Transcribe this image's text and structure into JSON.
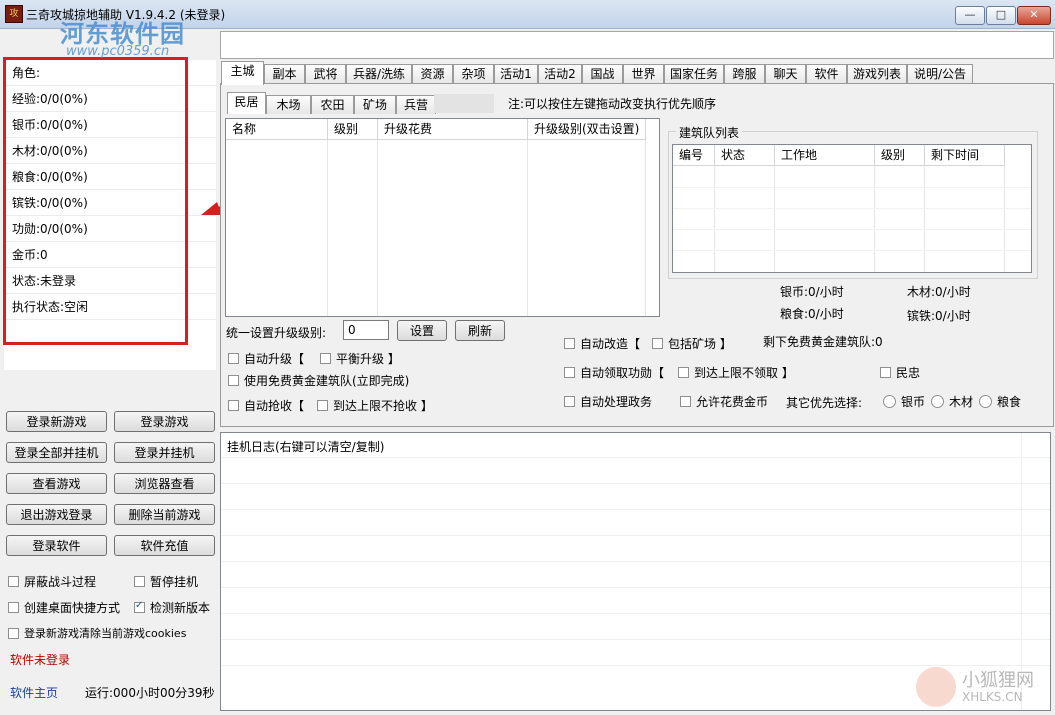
{
  "window": {
    "title": "三奇攻城掠地辅助 V1.9.4.2 (未登录)",
    "icon_text": "攻",
    "minimize": "—",
    "maximize": "□",
    "close": "✕"
  },
  "watermark": {
    "text": "河东软件园",
    "url": "www.pc0359.cn"
  },
  "stats": [
    "角色:",
    "经验:0/0(0%)",
    "银币:0/0(0%)",
    "木材:0/0(0%)",
    "粮食:0/0(0%)",
    "镔铁:0/0(0%)",
    "功勋:0/0(0%)",
    "金币:0",
    "状态:未登录",
    "执行状态:空闲"
  ],
  "buttons": [
    "登录新游戏",
    "登录游戏",
    "登录全部并挂机",
    "登录并挂机",
    "查看游戏",
    "浏览器查看",
    "退出游戏登录",
    "删除当前游戏",
    "登录软件",
    "软件充值"
  ],
  "left_options": {
    "block_battle": "屏蔽战斗过程",
    "pause_hang": "暂停挂机",
    "desktop_shortcut": "创建桌面快捷方式",
    "check_version": "检测新版本",
    "clear_cookies": "登录新游戏清除当前游戏cookies"
  },
  "software_status": "软件未登录",
  "homepage_link": "软件主页",
  "runtime": "运行:000小时00分39秒",
  "tabs": [
    "主城",
    "副本",
    "武将",
    "兵器/洗练",
    "资源",
    "杂项",
    "活动1",
    "活动2",
    "国战",
    "世界",
    "国家任务",
    "跨服",
    "聊天",
    "软件",
    "游戏列表",
    "说明/公告"
  ],
  "subtabs": [
    "民居",
    "木场",
    "农田",
    "矿场",
    "兵营"
  ],
  "hint": "注:可以按住左键拖动改变执行优先顺序",
  "building_grid": {
    "headers": [
      "名称",
      "级别",
      "升级花费",
      "升级级别(双击设置)"
    ]
  },
  "queue": {
    "title": "建筑队列表",
    "headers": [
      "编号",
      "状态",
      "工作地",
      "级别",
      "剩下时间"
    ]
  },
  "rates": {
    "silver": "银币:0/小时",
    "wood": "木材:0/小时",
    "food": "粮食:0/小时",
    "iron": "镔铁:0/小时"
  },
  "unify": {
    "label": "统一设置升级级别:",
    "value": "0",
    "set": "设置",
    "refresh": "刷新"
  },
  "options": {
    "auto_upgrade": "自动升级【",
    "balanced_upgrade": "平衡升级 】",
    "use_free_gold": "使用免费黄金建筑队(立即完成)",
    "auto_grab": "自动抢收【",
    "no_grab_limit": "到达上限不抢收 】",
    "auto_reform": "自动改造【",
    "include_mine": "包括矿场 】",
    "free_gold_left": "剩下免费黄金建筑队:0",
    "auto_merit": "自动领取功勋【",
    "no_take_limit": "到达上限不领取 】",
    "civil": "民忠",
    "auto_affairs": "自动处理政务",
    "allow_gold": "允许花费金币",
    "other_priority": "其它优先选择:",
    "radio_silver": "银币",
    "radio_wood": "木材",
    "radio_food": "粮食"
  },
  "log": {
    "title": "挂机日志(右键可以清空/复制)"
  },
  "corner_watermark": {
    "name": "小狐狸网",
    "url": "XHLKS.CN"
  },
  "colors": {
    "highlight_box": "#d6201f",
    "status_red": "#c00000",
    "link_blue": "#1a3fa0"
  }
}
